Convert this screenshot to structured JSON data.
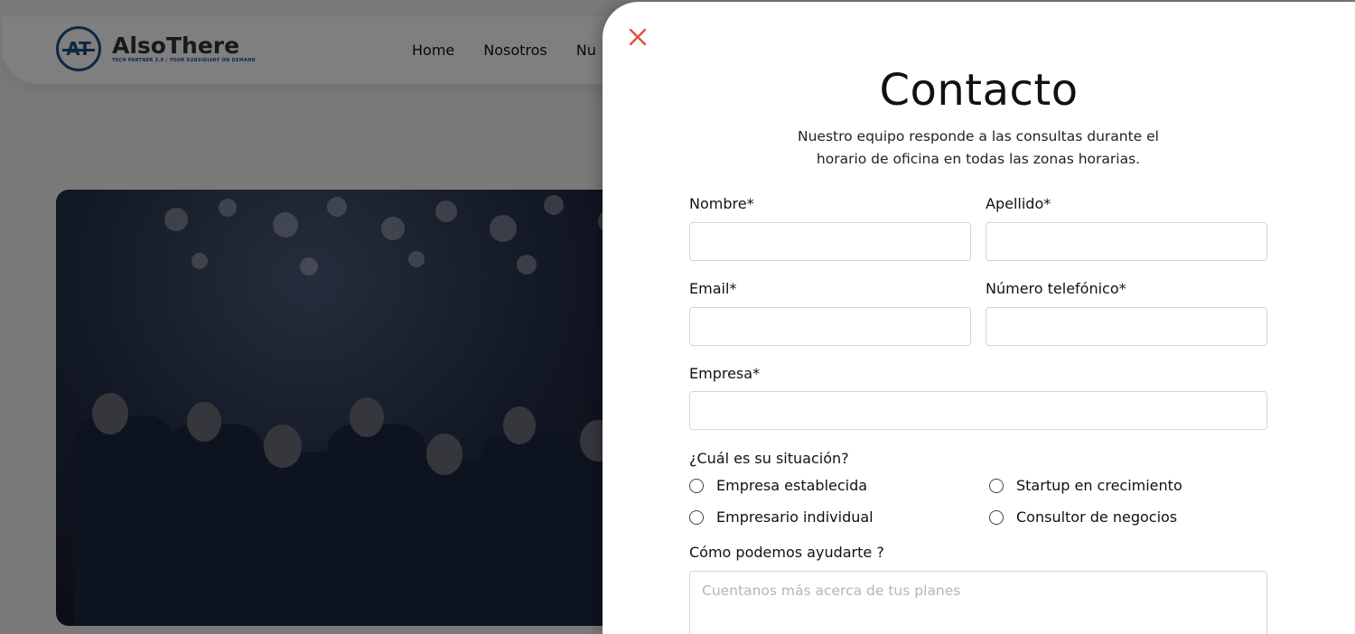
{
  "site": {
    "logo_text": "AlsoThere",
    "logo_tagline": "TECH PARTNER 2.0 / YOUR SUBSIDIARY ON DEMAND",
    "logo_mark": "AT",
    "nav": [
      "Home",
      "Nosotros",
      "Nu"
    ]
  },
  "contact": {
    "title": "Contacto",
    "subtitle": "Nuestro equipo responde a las consultas durante el horario de oficina en todas las zonas horarias.",
    "fields": {
      "nombre": {
        "label": "Nombre*",
        "value": ""
      },
      "apellido": {
        "label": "Apellido*",
        "value": ""
      },
      "email": {
        "label": "Email*",
        "value": ""
      },
      "telefono": {
        "label": "Número telefónico*",
        "value": ""
      },
      "empresa": {
        "label": "Empresa*",
        "value": ""
      }
    },
    "situation": {
      "label": "¿Cuál es su situación?",
      "options": [
        "Empresa establecida",
        "Startup en crecimiento",
        "Empresario individual",
        "Consultor de negocios"
      ]
    },
    "help": {
      "label": "Cómo podemos ayudarte ?",
      "placeholder": "Cuentanos más acerca de tus planes"
    }
  },
  "colors": {
    "close_icon": "#e0503c",
    "logo_blue": "#1f4f8a",
    "overlay": "#000000"
  }
}
